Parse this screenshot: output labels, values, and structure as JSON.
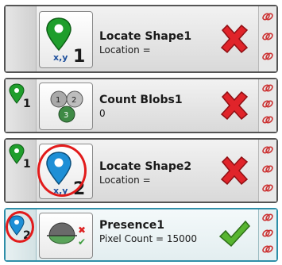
{
  "tools": [
    {
      "name": "Locate Shape1",
      "detail": "Location =",
      "icon": "locate-shape-icon",
      "icon_number": "1",
      "icon_caption": "x,y",
      "status": "fail",
      "reference_number": ""
    },
    {
      "name": "Count Blobs1",
      "detail": "0",
      "icon": "count-blobs-icon",
      "blob_numbers": [
        "1",
        "2",
        "3"
      ],
      "status": "fail",
      "reference_number": "1"
    },
    {
      "name": "Locate Shape2",
      "detail": "Location =",
      "icon": "locate-shape-icon",
      "icon_number": "2",
      "icon_caption": "x,y",
      "status": "fail",
      "reference_number": "1"
    },
    {
      "name": "Presence1",
      "detail": "Pixel Count = 15000",
      "icon": "presence-icon",
      "status": "pass",
      "reference_number": "2"
    }
  ],
  "colors": {
    "green_pin": "#1f9e2c",
    "blue_pin": "#1e8fd6",
    "fail_x": "#e0242a",
    "pass_check": "#58b530",
    "highlight_circle": "#e21b1b",
    "selected_border": "#2e8ea8"
  }
}
